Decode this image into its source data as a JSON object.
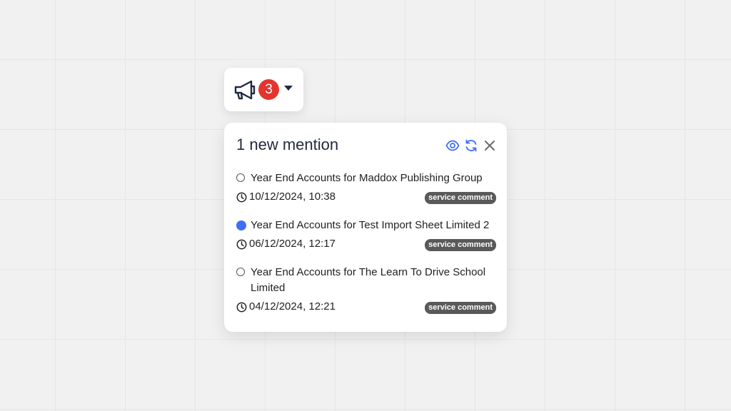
{
  "notification_button": {
    "badge_count": "3",
    "icons": {
      "main": "megaphone-icon",
      "dropdown": "caret-down-icon"
    },
    "badge_color": "#e3342f"
  },
  "panel": {
    "title": "1 new mention",
    "actions": [
      {
        "name": "mark-read",
        "icon": "eye-icon"
      },
      {
        "name": "refresh",
        "icon": "refresh-icon"
      },
      {
        "name": "close",
        "icon": "close-icon"
      }
    ],
    "accent_color": "#3d6ef5",
    "items": [
      {
        "title": "Year End Accounts for Maddox Publishing Group",
        "date": "10/12/2024, 10:38",
        "tag": "service comment",
        "unread": false
      },
      {
        "title": "Year End Accounts for Test Import Sheet Limited 2",
        "date": "06/12/2024, 12:17",
        "tag": "service comment",
        "unread": true
      },
      {
        "title": "Year End Accounts for The Learn To Drive School Limited",
        "date": "04/12/2024, 12:21",
        "tag": "service comment",
        "unread": false
      }
    ]
  }
}
